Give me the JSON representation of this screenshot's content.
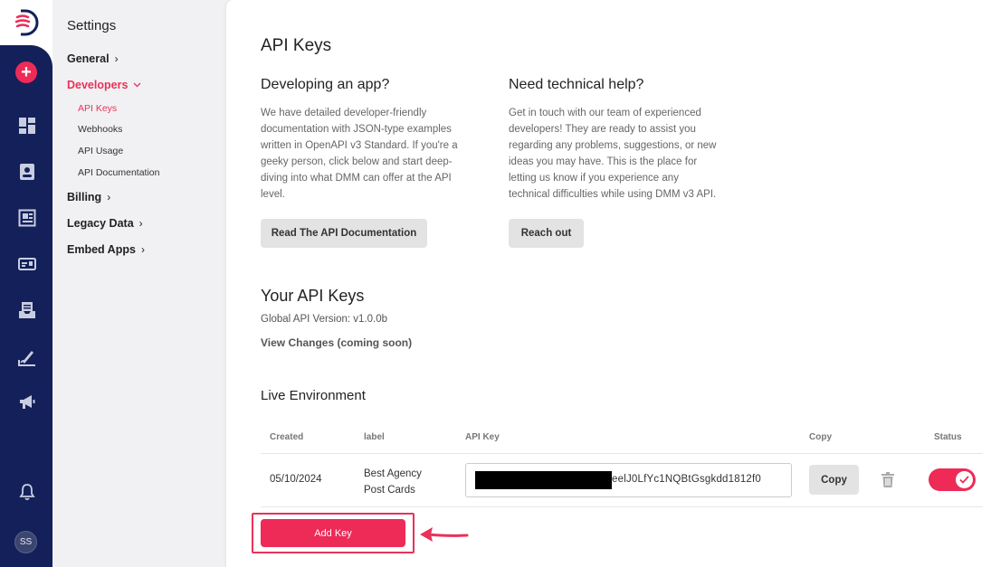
{
  "rail": {
    "add_label": "+",
    "avatar": "SS",
    "icons": [
      "dashboard-icon",
      "contacts-icon",
      "gallery-icon",
      "id-card-icon",
      "inbox-icon",
      "signature-icon",
      "megaphone-icon",
      "bell-icon"
    ]
  },
  "sidebar": {
    "title": "Settings",
    "general": "General",
    "developers": "Developers",
    "sub": {
      "api_keys": "API Keys",
      "webhooks": "Webhooks",
      "api_usage": "API Usage",
      "api_docs": "API Documentation"
    },
    "billing": "Billing",
    "legacy": "Legacy Data",
    "embed": "Embed Apps"
  },
  "main": {
    "title": "API Keys",
    "dev": {
      "heading": "Developing an app?",
      "lines": [
        "We have detailed developer-friendly",
        "documentation with JSON-type examples",
        "written in OpenAPI v3 Standard. If you're a",
        "geeky person, click below and start deep-",
        "diving into what DMM can offer at the API",
        "level."
      ],
      "button": "Read The API Documentation"
    },
    "help": {
      "heading": "Need technical help?",
      "lines": [
        "Get in touch with our team of experienced",
        "developers! They are ready to assist you",
        "regarding any problems, suggestions, or new",
        "ideas you may have. This is the place for",
        "letting us know if you experience any",
        "technical difficulties while using DMM v3 API."
      ],
      "button": "Reach out"
    },
    "your_keys": "Your API Keys",
    "version": "Global API Version: v1.0.0b",
    "view_changes": "View Changes (coming soon)",
    "live_env": "Live Environment",
    "table": {
      "headers": {
        "created": "Created",
        "label": "label",
        "api_key": "API Key",
        "copy": "Copy",
        "status": "Status"
      },
      "row": {
        "created": "05/10/2024",
        "label_line1": "Best Agency",
        "label_line2": "Post Cards",
        "key_visible": "eelJ0LfYc1NQBtGsgkdd1812f0",
        "copy": "Copy",
        "status_on": true
      }
    },
    "add_key": "Add Key"
  },
  "colors": {
    "accent": "#ee2a57",
    "rail": "#13205a"
  }
}
